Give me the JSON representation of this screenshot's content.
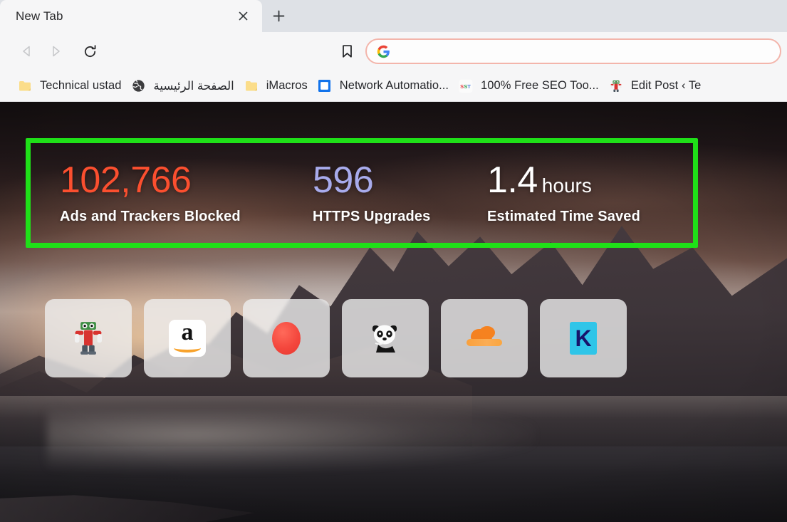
{
  "window": {
    "tab": {
      "title": "New Tab",
      "close_icon": "close-icon",
      "newtab_icon": "plus-icon"
    }
  },
  "toolbar": {
    "back_icon": "back-arrow-icon",
    "forward_icon": "forward-arrow-icon",
    "reload_icon": "reload-icon",
    "bookmark_icon": "bookmark-ribbon-icon",
    "omnibox": {
      "search_engine_icon": "google-g-icon",
      "value": "",
      "placeholder": "",
      "focused": true
    }
  },
  "bookmarks_bar": {
    "items": [
      {
        "label": "Technical ustad",
        "icon": "folder-icon",
        "rtl": false
      },
      {
        "label": "الصفحة الرئيسية",
        "icon": "globe-icon",
        "rtl": true
      },
      {
        "label": "iMacros",
        "icon": "folder-icon",
        "rtl": false
      },
      {
        "label": "Network Automatio...",
        "icon": "blue-square-icon",
        "rtl": false
      },
      {
        "label": "100% Free SEO Too...",
        "icon": "sst-favicon",
        "rtl": false
      },
      {
        "label": "Edit Post ‹ Te",
        "icon": "wordpress-robot-icon",
        "rtl": false
      }
    ]
  },
  "newtab": {
    "stats": {
      "highlight_color": "#1fe018",
      "items": [
        {
          "value": "102,766",
          "unit": "",
          "label": "Ads and Trackers Blocked",
          "color": "#fb4f2f"
        },
        {
          "value": "596",
          "unit": "",
          "label": "HTTPS Upgrades",
          "color": "#a8abec"
        },
        {
          "value": "1.4",
          "unit": "hours",
          "label": "Estimated Time Saved",
          "color": "#ffffff"
        }
      ]
    },
    "top_sites": [
      {
        "name": "wordpress-robot-shortcut",
        "icon": "wordpress-robot-icon"
      },
      {
        "name": "amazon-shortcut",
        "icon": "amazon-icon"
      },
      {
        "name": "red-ellipse-shortcut",
        "icon": "red-ellipse-icon"
      },
      {
        "name": "panda-shortcut",
        "icon": "panda-icon"
      },
      {
        "name": "cloudflare-shortcut",
        "icon": "cloudflare-icon"
      },
      {
        "name": "kinsta-shortcut",
        "icon": "kinsta-k-icon"
      }
    ]
  }
}
